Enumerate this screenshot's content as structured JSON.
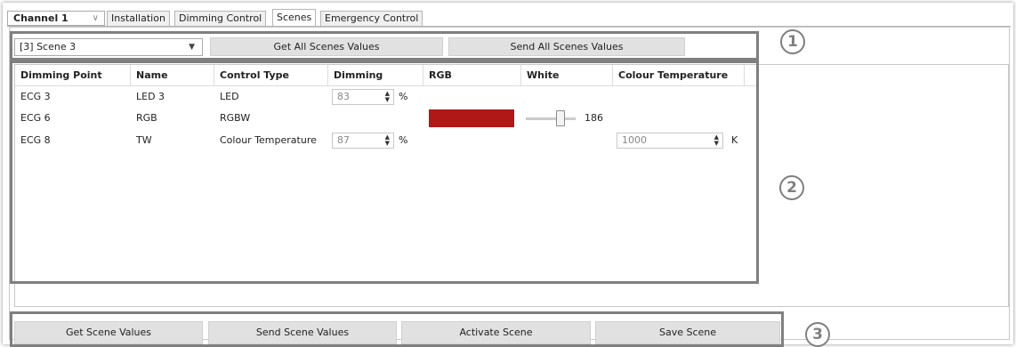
{
  "channel": {
    "label": "Channel 1"
  },
  "tabs": [
    {
      "label": "Installation"
    },
    {
      "label": "Dimming Control"
    },
    {
      "label": "Scenes"
    },
    {
      "label": "Emergency Control"
    }
  ],
  "toolbar": {
    "scene_selected": "[3] Scene 3",
    "get_all_label": "Get All Scenes Values",
    "send_all_label": "Send All Scenes Values"
  },
  "callouts": [
    "1",
    "2",
    "3"
  ],
  "grid": {
    "headers": [
      "Dimming Point",
      "Name",
      "Control Type",
      "Dimming",
      "RGB",
      "White",
      "Colour Temperature"
    ],
    "rows": [
      {
        "point": "ECG 3",
        "name": "LED 3",
        "type": "LED",
        "dimming": "83",
        "dimming_unit": "%"
      },
      {
        "point": "ECG 6",
        "name": "RGB",
        "type": "RGBW",
        "rgb_color": "#b01818",
        "white_value": "186",
        "white_level": 0.73
      },
      {
        "point": "ECG 8",
        "name": "TW",
        "type": "Colour Temperature",
        "dimming": "87",
        "dimming_unit": "%",
        "colour_temp": "1000",
        "colour_temp_unit": "K"
      }
    ]
  },
  "bottom": {
    "get_label": "Get Scene Values",
    "send_label": "Send Scene Values",
    "activate_label": "Activate Scene",
    "save_label": "Save Scene"
  }
}
